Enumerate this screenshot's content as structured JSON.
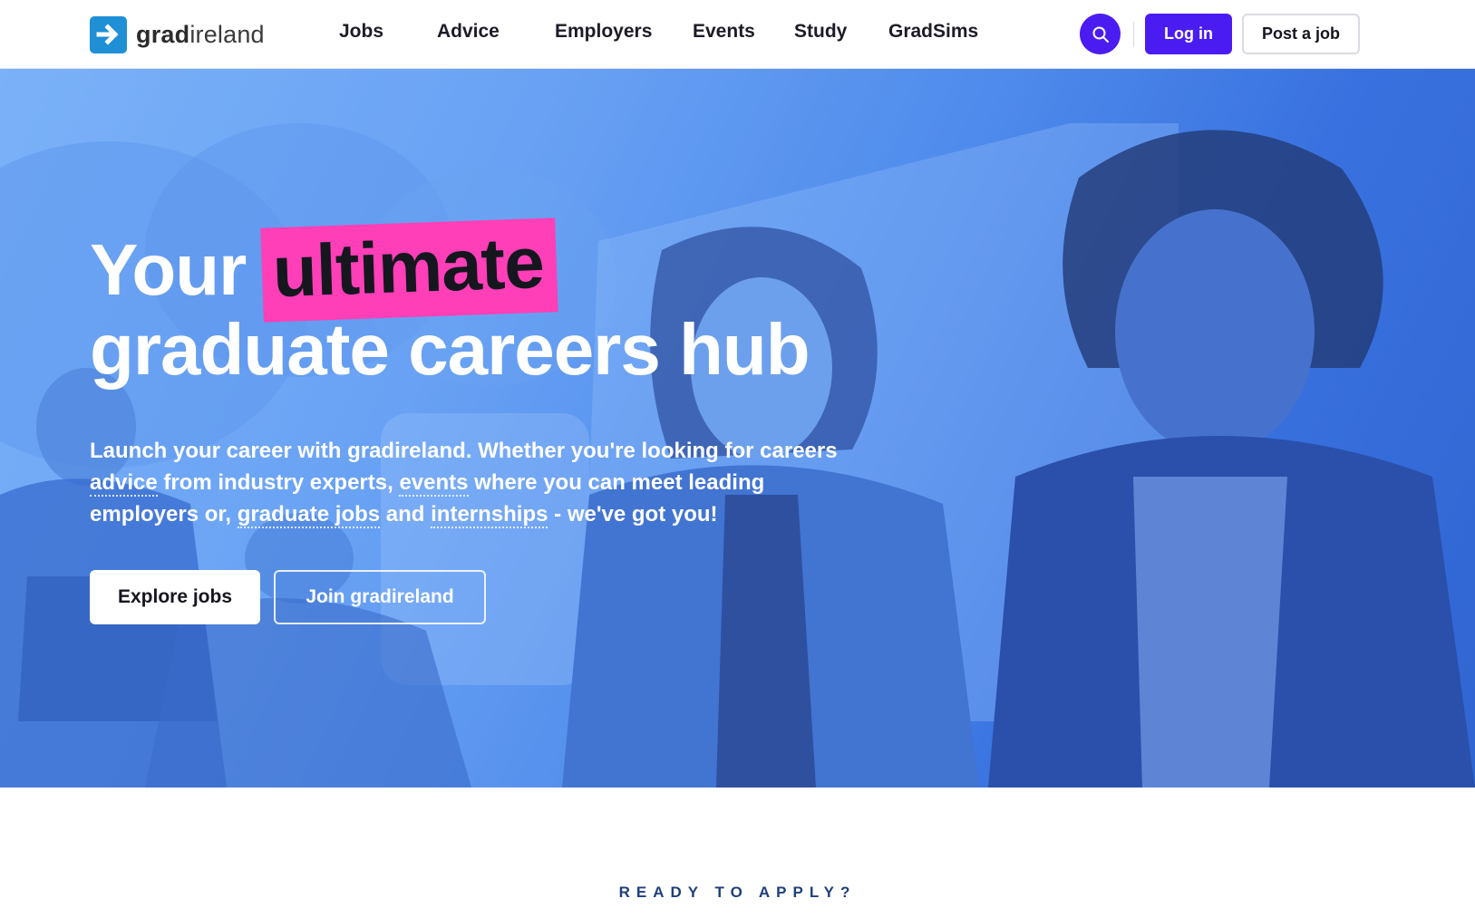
{
  "brand": {
    "name_bold": "grad",
    "name_light": "ireland",
    "logo_color": "#1f8fd6"
  },
  "nav": {
    "items": [
      {
        "label": "Jobs"
      },
      {
        "label": "Advice"
      },
      {
        "label": "Employers"
      },
      {
        "label": "Events"
      },
      {
        "label": "Study"
      },
      {
        "label": "GradSims"
      }
    ]
  },
  "header_actions": {
    "search_icon": "search-icon",
    "login_label": "Log in",
    "post_job_label": "Post a job",
    "accent_color": "#4b1cf2"
  },
  "hero": {
    "title_part1": "Your",
    "title_highlight": "ultimate",
    "title_part2": "graduate careers hub",
    "highlight_color": "#ff3fb8",
    "description": {
      "t1": "Launch your career with gradireland. Whether you're looking for careers ",
      "link_advice": "advice",
      "t2": " from industry experts, ",
      "link_events": "events",
      "t3": " where you can meet leading employers or, ",
      "link_jobs": "graduate jobs",
      "t4": " and ",
      "link_internships": "internships",
      "t5": " - we've got you!"
    },
    "primary_cta": "Explore jobs",
    "secondary_cta": "Join gradireland"
  },
  "section": {
    "eyebrow": "READY TO APPLY?"
  }
}
